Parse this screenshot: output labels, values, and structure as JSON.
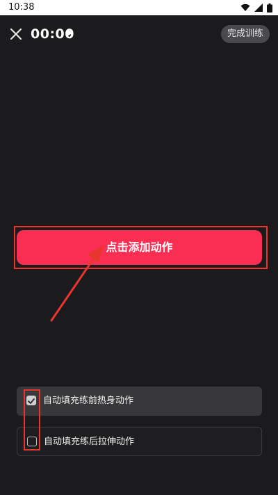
{
  "status_bar": {
    "time": "10:38"
  },
  "header": {
    "timer": "00:00",
    "finish_label": "完成训练"
  },
  "main": {
    "add_action_label": "点击添加动作"
  },
  "options": [
    {
      "label": "自动填充练前热身动作",
      "checked": true
    },
    {
      "label": "自动填充练后拉伸动作",
      "checked": false
    }
  ],
  "icons": {
    "close": "close-icon",
    "play": "play-icon",
    "wifi": "wifi-icon",
    "signal": "signal-icon",
    "battery": "battery-icon",
    "check": "checkmark-icon"
  },
  "colors": {
    "background": "#1b1b1d",
    "accent": "#fa2d52",
    "annotation": "#e8362f",
    "status_bar": "#ffffff"
  }
}
